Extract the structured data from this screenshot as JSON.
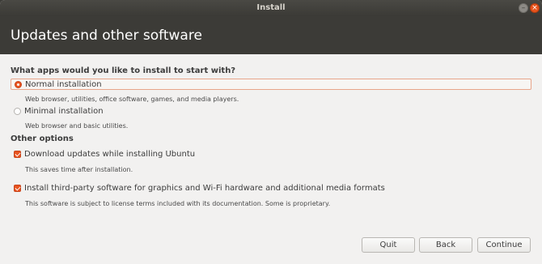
{
  "window": {
    "title": "Install",
    "minimize_glyph": "–",
    "close_glyph": "×"
  },
  "header": {
    "title": "Updates and other software"
  },
  "question": "What apps would you like to install to start with?",
  "install_options": [
    {
      "label": "Normal installation",
      "description": "Web browser, utilities, office software, games, and media players.",
      "selected": true
    },
    {
      "label": "Minimal installation",
      "description": "Web browser and basic utilities.",
      "selected": false
    }
  ],
  "other_options_heading": "Other options",
  "other_options": [
    {
      "label": "Download updates while installing Ubuntu",
      "description": "This saves time after installation.",
      "checked": true
    },
    {
      "label": "Install third-party software for graphics and Wi-Fi hardware and additional media formats",
      "description": "This software is subject to license terms included with its documentation. Some is proprietary.",
      "checked": true
    }
  ],
  "buttons": {
    "quit": "Quit",
    "back": "Back",
    "continue": "Continue"
  },
  "colors": {
    "accent": "#e95420",
    "header_bg": "#3c3b37",
    "content_bg": "#f2f1f0"
  }
}
